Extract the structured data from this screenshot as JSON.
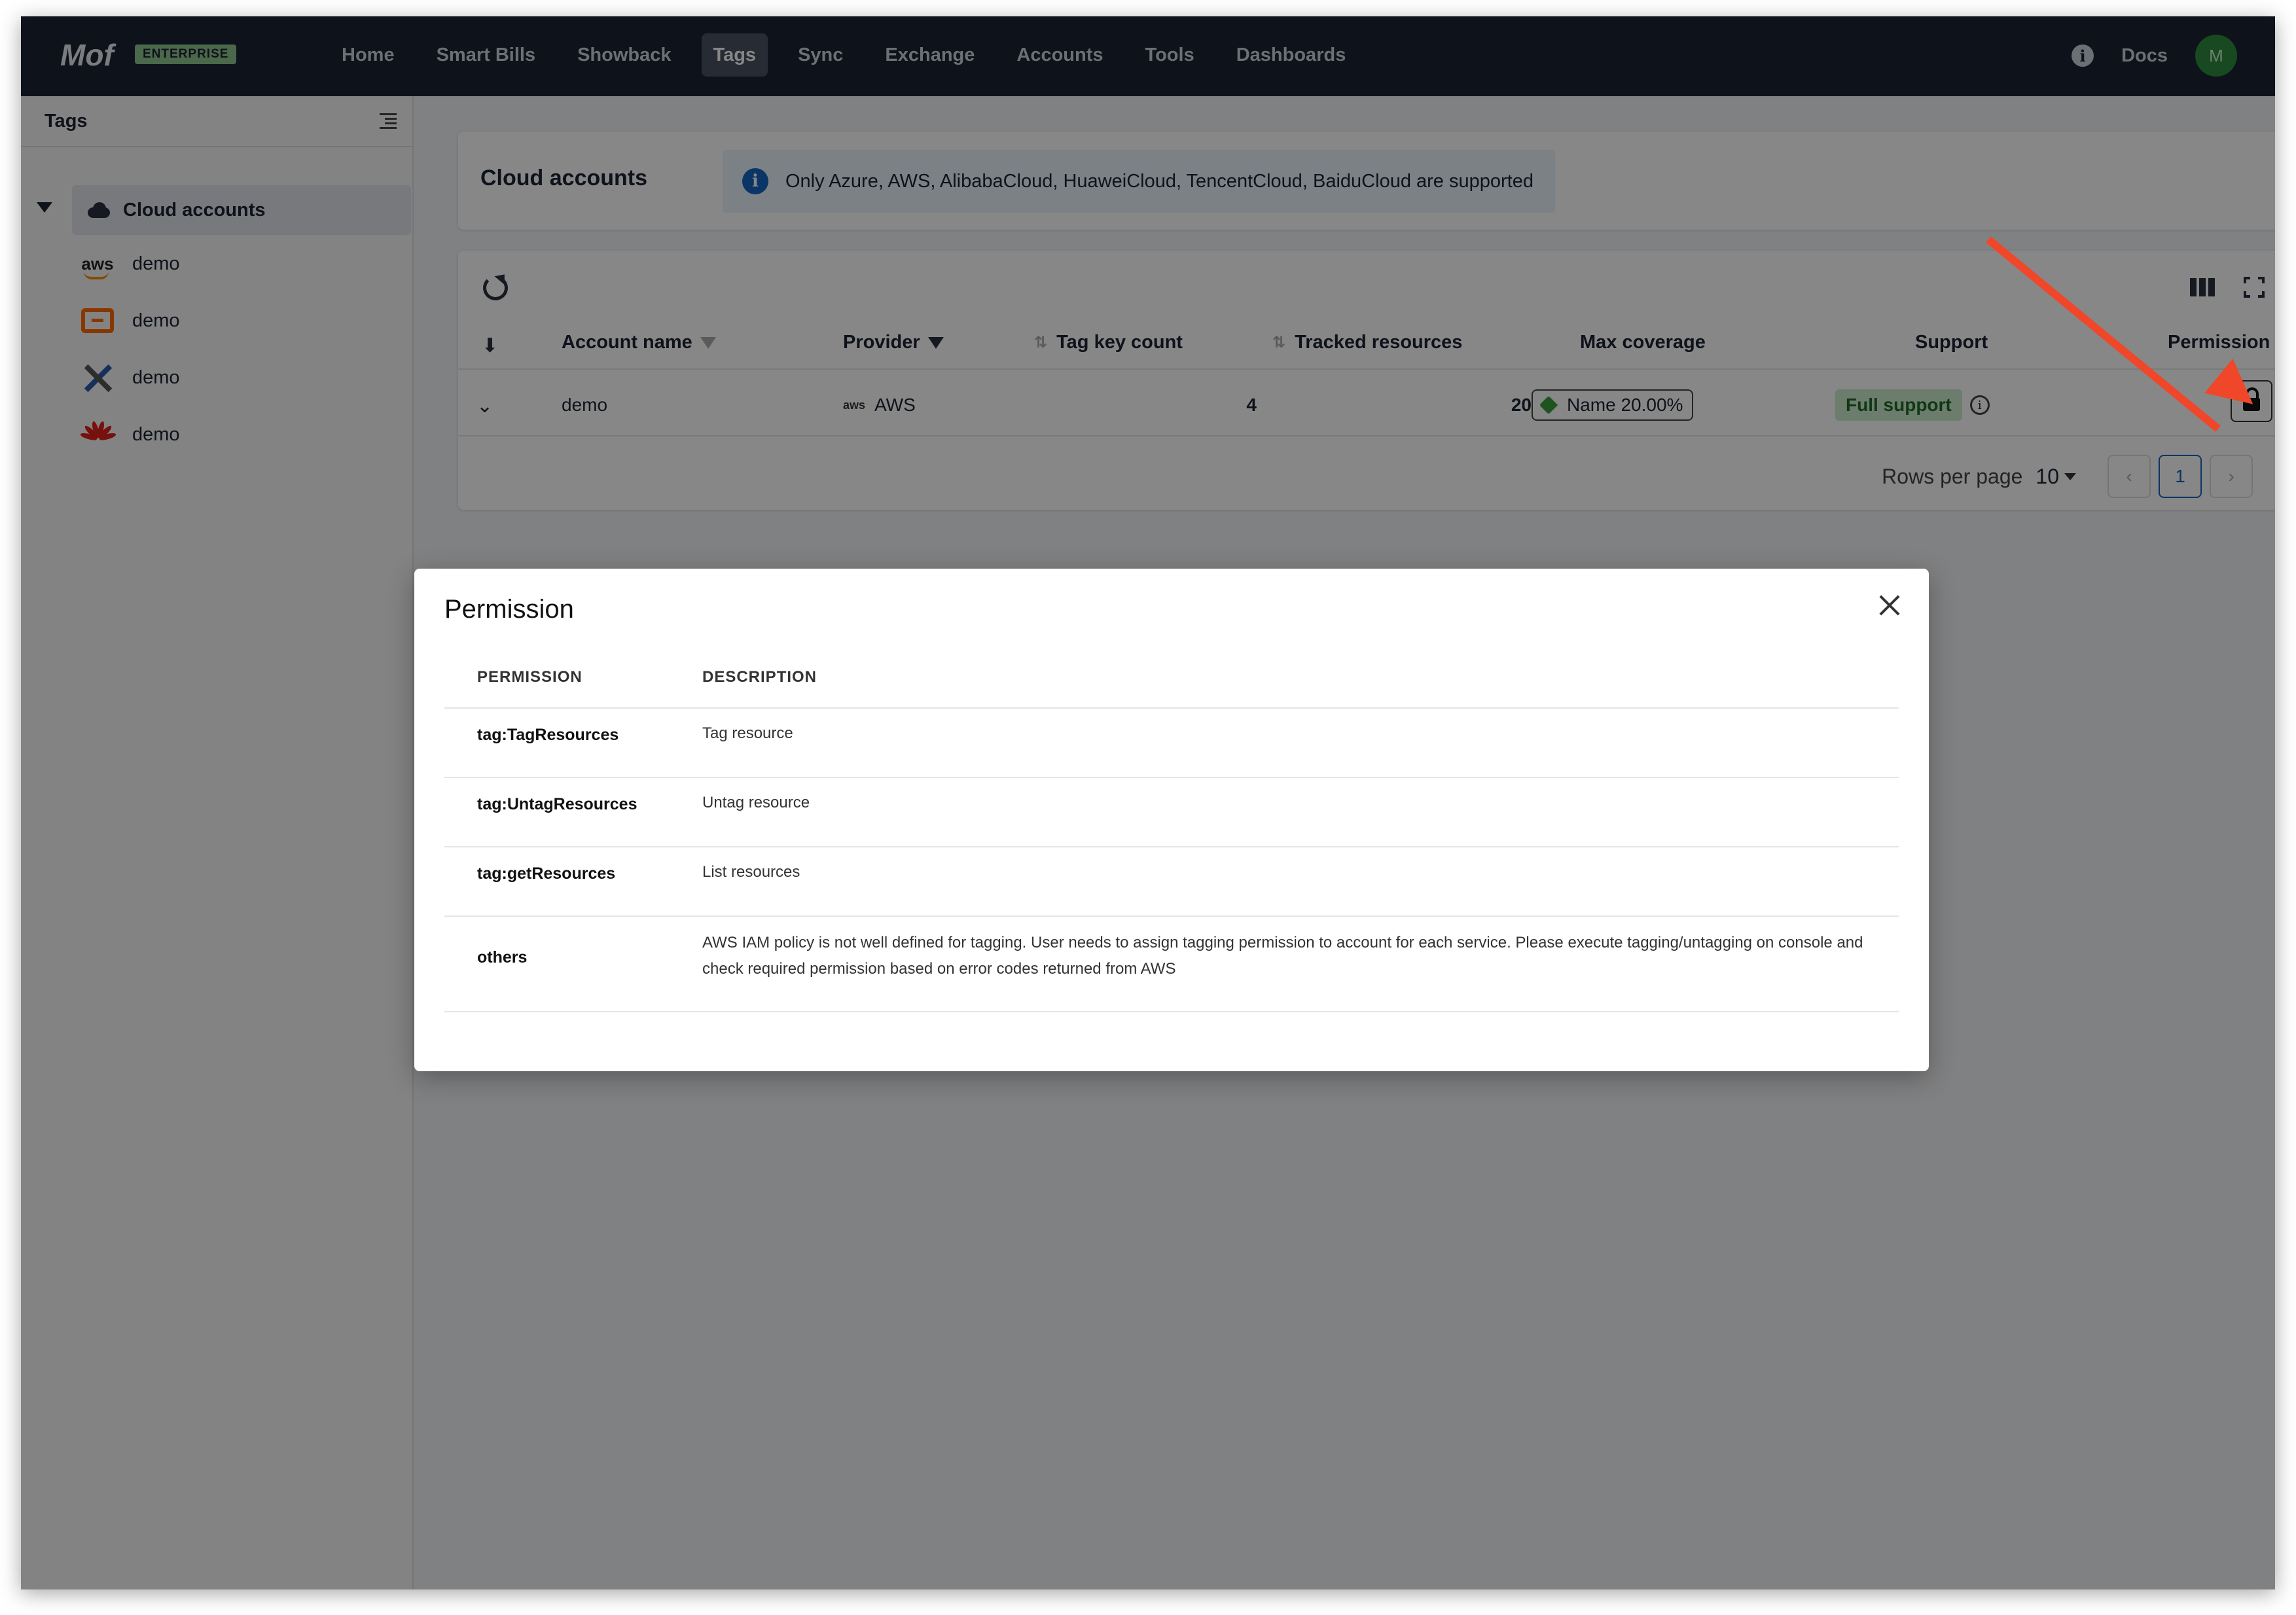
{
  "topnav": {
    "logo": "Mof",
    "badge": "ENTERPRISE",
    "items": [
      "Home",
      "Smart Bills",
      "Showback",
      "Tags",
      "Sync",
      "Exchange",
      "Accounts",
      "Tools",
      "Dashboards"
    ],
    "active_item": "Tags",
    "docs_label": "Docs",
    "avatar_initial": "M"
  },
  "sidebar": {
    "title": "Tags",
    "root_label": "Cloud accounts",
    "items": [
      {
        "label": "demo",
        "icon": "aws-icon"
      },
      {
        "label": "demo",
        "icon": "alibaba-cloud-icon"
      },
      {
        "label": "demo",
        "icon": "tools-icon"
      },
      {
        "label": "demo",
        "icon": "huawei-icon"
      }
    ]
  },
  "accounts_panel": {
    "title": "Cloud accounts",
    "alert_text": "Only Azure, AWS, AlibabaCloud, HuaweiCloud, TencentCloud, BaiduCloud are supported"
  },
  "table": {
    "headers": {
      "account_name": "Account name",
      "provider": "Provider",
      "tag_key_count": "Tag key count",
      "tracked_resources": "Tracked resources",
      "max_coverage": "Max coverage",
      "support": "Support",
      "permission": "Permission"
    },
    "rows": [
      {
        "account_name": "demo",
        "provider": "AWS",
        "tag_key_count": "4",
        "tracked_resources": "20",
        "max_coverage": "Name 20.00%",
        "support": "Full support"
      }
    ],
    "pagination": {
      "rows_per_page_label": "Rows per page",
      "rows_per_page": "10",
      "current_page": "1"
    }
  },
  "modal": {
    "title": "Permission",
    "headers": {
      "permission": "PERMISSION",
      "description": "DESCRIPTION"
    },
    "rows": [
      {
        "permission": "tag:TagResources",
        "description": "Tag resource"
      },
      {
        "permission": "tag:UntagResources",
        "description": "Untag resource"
      },
      {
        "permission": "tag:getResources",
        "description": "List resources"
      },
      {
        "permission": "others",
        "description": "AWS IAM policy is not well defined for tagging. User needs to assign tagging permission to account for each service. Please execute tagging/untagging on console and check required permission based on error codes returned from AWS"
      }
    ]
  },
  "colors": {
    "nav_bg": "#1b2233",
    "accent_arrow": "#f0472a",
    "support_badge": "#cdeccf",
    "alert_bg": "#e8f3fc"
  }
}
